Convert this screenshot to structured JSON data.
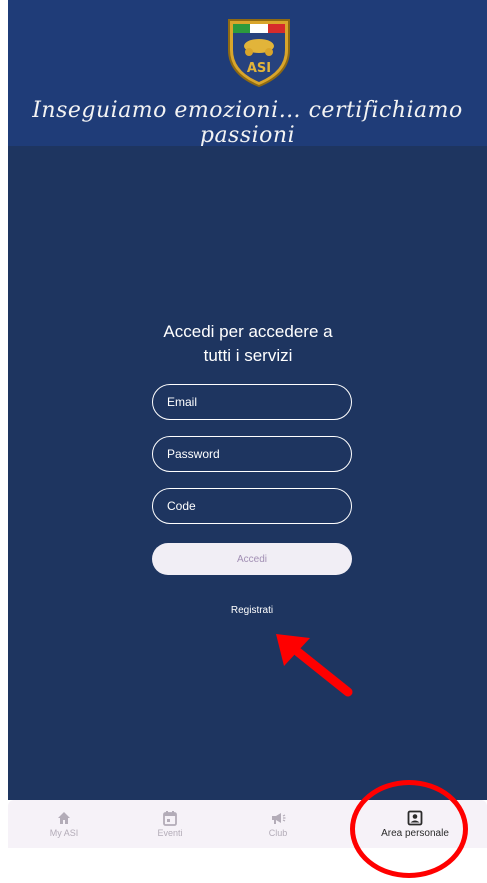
{
  "header": {
    "logo_text": "ASI",
    "tagline": "Inseguiamo emozioni… certifichiamo passioni"
  },
  "login": {
    "title_line1": "Accedi per accedere a",
    "title_line2": "tutti i servizi",
    "email_placeholder": "Email",
    "password_placeholder": "Password",
    "code_placeholder": "Code",
    "submit_label": "Accedi",
    "register_link": "Registrati"
  },
  "nav": {
    "items": [
      {
        "label": "My ASI",
        "icon": "home-icon"
      },
      {
        "label": "Eventi",
        "icon": "calendar-icon"
      },
      {
        "label": "Club",
        "icon": "megaphone-icon"
      },
      {
        "label": "Area personale",
        "icon": "account-box-icon"
      }
    ],
    "active_index": 3
  },
  "colors": {
    "header_bg": "#1f3c78",
    "main_bg": "#1e3560",
    "button_bg": "#f1eef5",
    "button_text": "#a28fb4",
    "annotation_red": "#ff0000"
  }
}
